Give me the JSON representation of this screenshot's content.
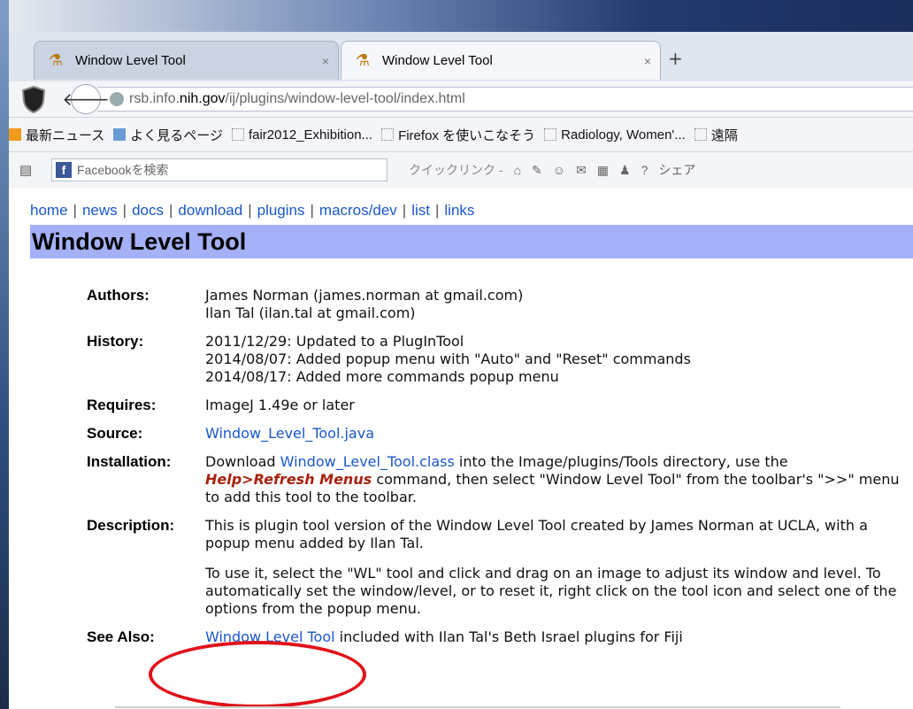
{
  "browser": {
    "tabs": [
      {
        "title": "Window Level Tool",
        "close": "×"
      },
      {
        "title": "Window Level Tool",
        "close": "×"
      }
    ],
    "new_tab": "+",
    "url": {
      "prefix": "rsb.info.",
      "host": "nih.gov",
      "path": "/ij/plugins/window-level-tool/index.html"
    },
    "bookmarks": [
      {
        "label": "最新ニュース",
        "icon": "rss-icon"
      },
      {
        "label": "よく見るページ",
        "icon": "page-icon"
      },
      {
        "label": "fair2012_Exhibition...",
        "icon": "bookmark-icon"
      },
      {
        "label": "Firefox を使いこなそう",
        "icon": "bookmark-icon"
      },
      {
        "label": "Radiology, Women'...",
        "icon": "bookmark-icon"
      },
      {
        "label": "遠隔",
        "icon": "bookmark-icon"
      }
    ],
    "toolbar": {
      "search_placeholder": "Facebookを検索",
      "quicklink": "クイックリンク ‐",
      "share": "シェア"
    }
  },
  "page": {
    "nav": [
      "home",
      "news",
      "docs",
      "download",
      "plugins",
      "macros/dev",
      "list",
      "links"
    ],
    "title": "Window Level Tool",
    "rows": {
      "authors": {
        "label": "Authors:",
        "lines": [
          "James Norman (james.norman at gmail.com)",
          "Ilan Tal (ilan.tal at gmail.com)"
        ]
      },
      "history": {
        "label": "History:",
        "lines": [
          "2011/12/29: Updated to a PlugInTool",
          "2014/08/07: Added popup menu with \"Auto\" and \"Reset\" commands",
          "2014/08/17: Added more commands popup menu"
        ]
      },
      "requires": {
        "label": "Requires:",
        "value": "ImageJ 1.49e or later"
      },
      "source": {
        "label": "Source:",
        "link": "Window_Level_Tool.java"
      },
      "installation": {
        "label": "Installation:",
        "t1": "Download ",
        "link": "Window_Level_Tool.class",
        "t2": " into the Image/plugins/Tools directory, use the ",
        "menu": "Help>Refresh Menus",
        "t3": " command, then select \"Window Level Tool\" from the toolbar's \">>\" menu to add this tool to the toolbar."
      },
      "description": {
        "label": "Description:",
        "p1": "This is plugin tool version of the Window Level Tool created by James Norman at UCLA, with a popup menu added by Ilan Tal.",
        "p2": "To use it, select the \"WL\" tool and click and drag on an image to adjust its window and level. To automatically set the window/level, or to reset it, right click on the tool icon and select one of the options from the popup menu."
      },
      "see_also": {
        "label": "See Also:",
        "link": "Window Level Tool",
        "rest": " included with Ilan Tal's Beth Israel plugins for Fiji"
      }
    }
  },
  "annotation": {
    "color": "#e0121a"
  }
}
